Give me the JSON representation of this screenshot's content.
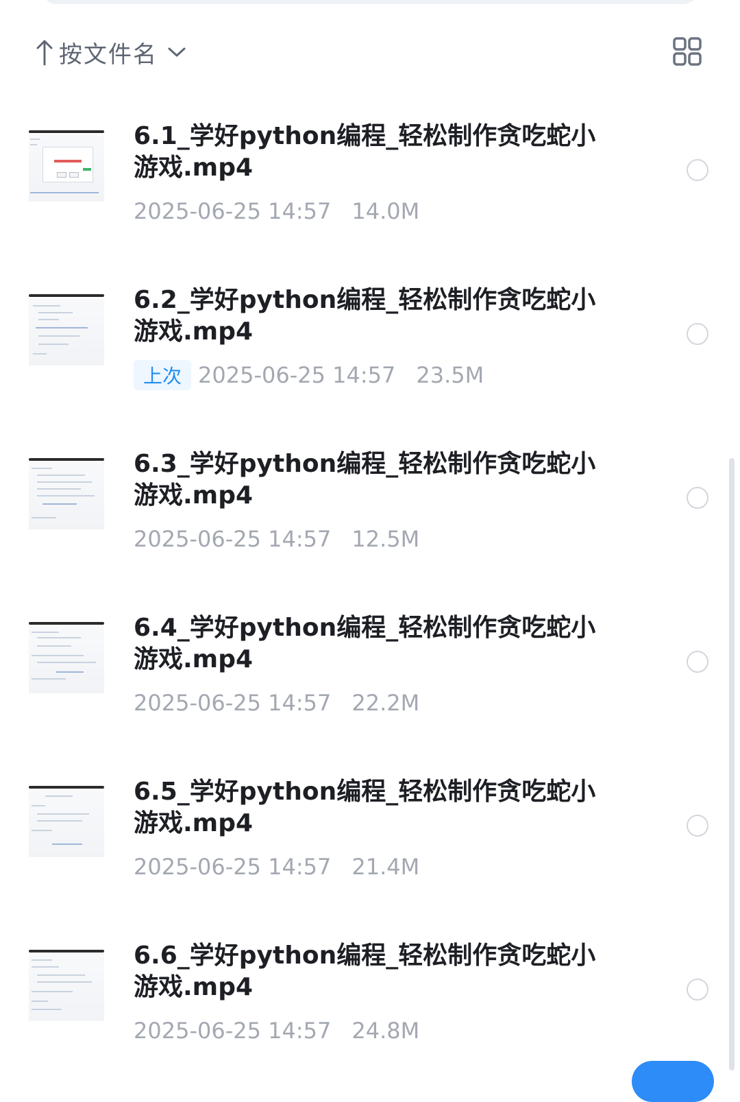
{
  "sort": {
    "label": "按文件名",
    "direction_icon": "arrow-up-icon",
    "dropdown_icon": "chevron-down-icon"
  },
  "view_toggle": {
    "icon": "grid-view-icon"
  },
  "files": [
    {
      "name": "6.1_学好python编程_轻松制作贪吃蛇小游戏.mp4",
      "date": "2025-06-25 14:57",
      "size": "14.0M",
      "badge": ""
    },
    {
      "name": "6.2_学好python编程_轻松制作贪吃蛇小游戏.mp4",
      "date": "2025-06-25 14:57",
      "size": "23.5M",
      "badge": "上次"
    },
    {
      "name": "6.3_学好python编程_轻松制作贪吃蛇小游戏.mp4",
      "date": "2025-06-25 14:57",
      "size": "12.5M",
      "badge": ""
    },
    {
      "name": "6.4_学好python编程_轻松制作贪吃蛇小游戏.mp4",
      "date": "2025-06-25 14:57",
      "size": "22.2M",
      "badge": ""
    },
    {
      "name": "6.5_学好python编程_轻松制作贪吃蛇小游戏.mp4",
      "date": "2025-06-25 14:57",
      "size": "21.4M",
      "badge": ""
    },
    {
      "name": "6.6_学好python编程_轻松制作贪吃蛇小游戏.mp4",
      "date": "2025-06-25 14:57",
      "size": "24.8M",
      "badge": ""
    }
  ]
}
